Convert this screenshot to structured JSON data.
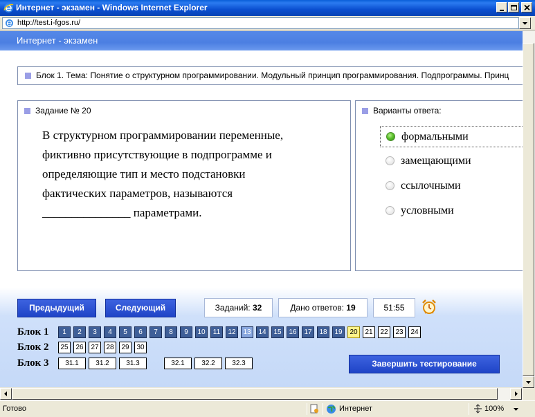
{
  "window": {
    "title": "Интернет - экзамен - Windows Internet Explorer"
  },
  "address": {
    "url": "http://test.i-fgos.ru/"
  },
  "page": {
    "header": "Интернет - экзамен",
    "block_title": "Блок 1. Тема: Понятие о структурном программировании. Модульный принцип программирования. Подпрограммы. Принц"
  },
  "question": {
    "heading": "Задание № 20",
    "lines": [
      "В структурном программировании переменные,",
      "фиктивно присутствующие в подпрограмме и",
      "определяющие тип и место подстановки",
      "фактических параметров, называются",
      "_______________ параметрами."
    ]
  },
  "answers": {
    "heading": "Варианты ответа:",
    "options": [
      {
        "label": "формальными",
        "selected": true
      },
      {
        "label": "замещающими",
        "selected": false
      },
      {
        "label": "ссылочными",
        "selected": false
      },
      {
        "label": "условными",
        "selected": false
      }
    ]
  },
  "nav": {
    "prev_label": "Предыдущий",
    "next_label": "Следующий",
    "tasks_label": "Заданий:",
    "tasks_value": "32",
    "answered_label": "Дано ответов:",
    "answered_value": "19",
    "timer": "51:55",
    "alarm_icon": "alarm-clock-icon"
  },
  "grid": {
    "block1_label": "Блок 1",
    "block2_label": "Блок 2",
    "block3_label": "Блок 3",
    "block1": [
      {
        "n": "1",
        "state": "answered"
      },
      {
        "n": "2",
        "state": "answered"
      },
      {
        "n": "3",
        "state": "answered"
      },
      {
        "n": "4",
        "state": "answered"
      },
      {
        "n": "5",
        "state": "answered"
      },
      {
        "n": "6",
        "state": "answered"
      },
      {
        "n": "7",
        "state": "answered"
      },
      {
        "n": "8",
        "state": "answered"
      },
      {
        "n": "9",
        "state": "answered"
      },
      {
        "n": "10",
        "state": "answered"
      },
      {
        "n": "11",
        "state": "answered"
      },
      {
        "n": "12",
        "state": "answered"
      },
      {
        "n": "13",
        "state": "current"
      },
      {
        "n": "14",
        "state": "answered"
      },
      {
        "n": "15",
        "state": "answered"
      },
      {
        "n": "16",
        "state": "answered"
      },
      {
        "n": "17",
        "state": "answered"
      },
      {
        "n": "18",
        "state": "answered"
      },
      {
        "n": "19",
        "state": "answered"
      },
      {
        "n": "20",
        "state": "active"
      },
      {
        "n": "21",
        "state": "empty"
      },
      {
        "n": "22",
        "state": "empty"
      },
      {
        "n": "23",
        "state": "empty"
      },
      {
        "n": "24",
        "state": "empty"
      }
    ],
    "block2": [
      "25",
      "26",
      "27",
      "28",
      "29",
      "30"
    ],
    "block3": [
      "31.1",
      "31.2",
      "31.3",
      "32.1",
      "32.2",
      "32.3"
    ],
    "finish_label": "Завершить тестирование"
  },
  "status": {
    "text": "Готово",
    "zone": "Интернет",
    "zoom": "100%"
  },
  "colors": {
    "title_bar": "#0a4fd0",
    "header_blue": "#4c7fe2",
    "button_blue": "#1f44c7",
    "answered_cell": "#3f5f98",
    "current_cell": "#8aa8df",
    "active_cell": "#fff38a",
    "bullet": "#9a9ee6"
  }
}
